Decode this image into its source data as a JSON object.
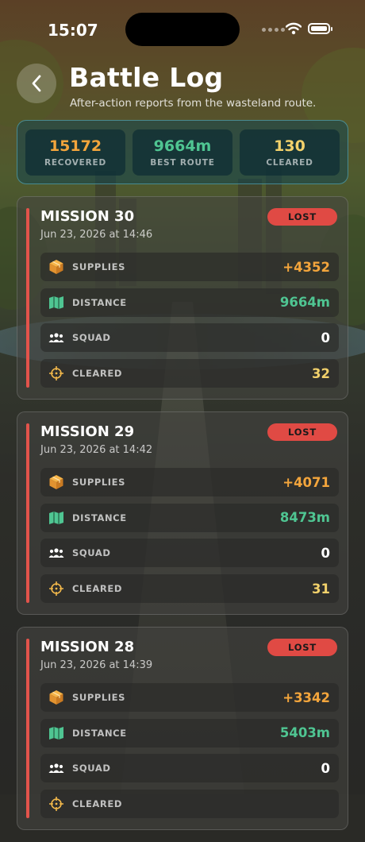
{
  "status_bar": {
    "time": "15:07"
  },
  "header": {
    "back_icon": "chevron-left-icon",
    "title": "Battle Log",
    "subtitle": "After-action reports from the wasteland route."
  },
  "summary": [
    {
      "value": "15172",
      "label": "RECOVERED",
      "color": "#f3a53c"
    },
    {
      "value": "9664m",
      "label": "BEST ROUTE",
      "color": "#4fc592"
    },
    {
      "value": "130",
      "label": "CLEARED",
      "color": "#f2d16b"
    }
  ],
  "missions": [
    {
      "name": "MISSION 30",
      "date": "Jun 23, 2026 at 14:46",
      "result": "LOST",
      "stats": [
        {
          "icon": "supplies-box-icon",
          "label": "SUPPLIES",
          "value": "+4352"
        },
        {
          "icon": "map-icon",
          "label": "DISTANCE",
          "value": "9664m"
        },
        {
          "icon": "squad-icon",
          "label": "SQUAD",
          "value": "0"
        },
        {
          "icon": "crosshair-icon",
          "label": "CLEARED",
          "value": "32"
        }
      ]
    },
    {
      "name": "MISSION 29",
      "date": "Jun 23, 2026 at 14:42",
      "result": "LOST",
      "stats": [
        {
          "icon": "supplies-box-icon",
          "label": "SUPPLIES",
          "value": "+4071"
        },
        {
          "icon": "map-icon",
          "label": "DISTANCE",
          "value": "8473m"
        },
        {
          "icon": "squad-icon",
          "label": "SQUAD",
          "value": "0"
        },
        {
          "icon": "crosshair-icon",
          "label": "CLEARED",
          "value": "31"
        }
      ]
    },
    {
      "name": "MISSION 28",
      "date": "Jun 23, 2026 at 14:39",
      "result": "LOST",
      "stats": [
        {
          "icon": "supplies-box-icon",
          "label": "SUPPLIES",
          "value": "+3342"
        },
        {
          "icon": "map-icon",
          "label": "DISTANCE",
          "value": "5403m"
        },
        {
          "icon": "squad-icon",
          "label": "SQUAD",
          "value": "0"
        },
        {
          "icon": "crosshair-icon",
          "label": "CLEARED",
          "value": ""
        }
      ]
    }
  ],
  "colors": {
    "lost_badge": "#e04a44",
    "supplies": "#f3a53c",
    "distance": "#4fc592",
    "squad": "#ffffff",
    "cleared": "#f2d16b"
  }
}
